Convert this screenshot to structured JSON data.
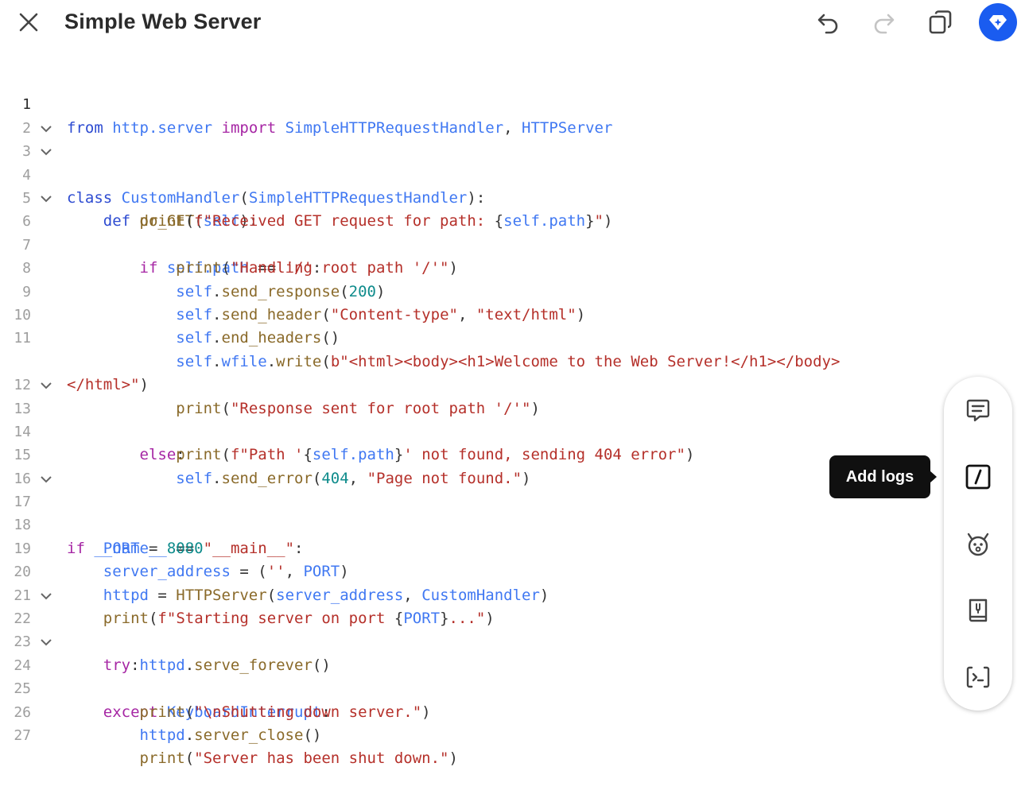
{
  "header": {
    "title": "Simple Web Server",
    "gem_color": "#1a5cf0"
  },
  "tooltip": {
    "label": "Add logs"
  },
  "icons": {
    "close": "close-icon",
    "undo": "undo-icon",
    "redo": "redo-icon",
    "copy": "copy-icon",
    "gem": "gem-icon",
    "tools": [
      "comment-icon",
      "slash-box-icon",
      "bug-icon",
      "book-icon",
      "terminal-icon"
    ]
  },
  "code": {
    "active_line": 1,
    "lines": [
      {
        "n": "1"
      },
      {
        "n": "2"
      },
      {
        "n": "3"
      },
      {
        "n": "4"
      },
      {
        "n": "5"
      },
      {
        "n": "6"
      },
      {
        "n": "7"
      },
      {
        "n": "8"
      },
      {
        "n": "9"
      },
      {
        "n": "10"
      },
      {
        "n": "11"
      },
      {
        "n": "12"
      },
      {
        "n": "13"
      },
      {
        "n": "14"
      },
      {
        "n": "15"
      },
      {
        "n": "16"
      },
      {
        "n": "17"
      },
      {
        "n": "18"
      },
      {
        "n": "19"
      },
      {
        "n": "20"
      },
      {
        "n": "21"
      },
      {
        "n": "22"
      },
      {
        "n": "23"
      },
      {
        "n": "24"
      },
      {
        "n": "25"
      },
      {
        "n": "26"
      },
      {
        "n": "27"
      }
    ],
    "t": {
      "from": "from",
      "http_server": "http.server",
      "import": "import",
      "SHRH": "SimpleHTTPRequestHandler",
      "HTTPServer": "HTTPServer",
      "class": "class",
      "CustomHandler": "CustomHandler",
      "def": "def",
      "do_GET": "do_GET",
      "self": "self",
      "print": "print",
      "f": "f",
      "s5": "\"Received GET request for path: ",
      "self_path": "self.path",
      "s5b": "\"",
      "if": "if",
      "slash": "'/'",
      "s7": "\"Handling root path '/'\"",
      "send_response": "send_response",
      "n200": "200",
      "send_header": "send_header",
      "s9a": "\"Content-type\"",
      "s9b": "\"text/html\"",
      "end_headers": "end_headers",
      "wfile": "wfile",
      "write": "write",
      "b": "b",
      "s11a": "\"<html><body><h1>Welcome to the Web Server!</h1></body>",
      "s11b": "</html>\"",
      "s12": "\"Response sent for root path '/'\"",
      "else": "else",
      "s14a": "\"Path '",
      "s14b": "' not found, sending 404 error\"",
      "send_error": "send_error",
      "n404": "404",
      "s15": "\"Page not found.\"",
      "name": "__name__",
      "main": "\"__main__\"",
      "PORT": "PORT",
      "n8080": "8080",
      "server_address": "server_address",
      "empty": "''",
      "httpd": "httpd",
      "s21a": "\"Starting server on port ",
      "s21b": "...\"",
      "try": "try",
      "serve_forever": "serve_forever",
      "except": "except",
      "KeyboardInterrupt": "KeyboardInterrupt",
      "s25": "\"\\nShutting down server.\"",
      "server_close": "server_close",
      "s27": "\"Server has been shut down.\""
    }
  }
}
